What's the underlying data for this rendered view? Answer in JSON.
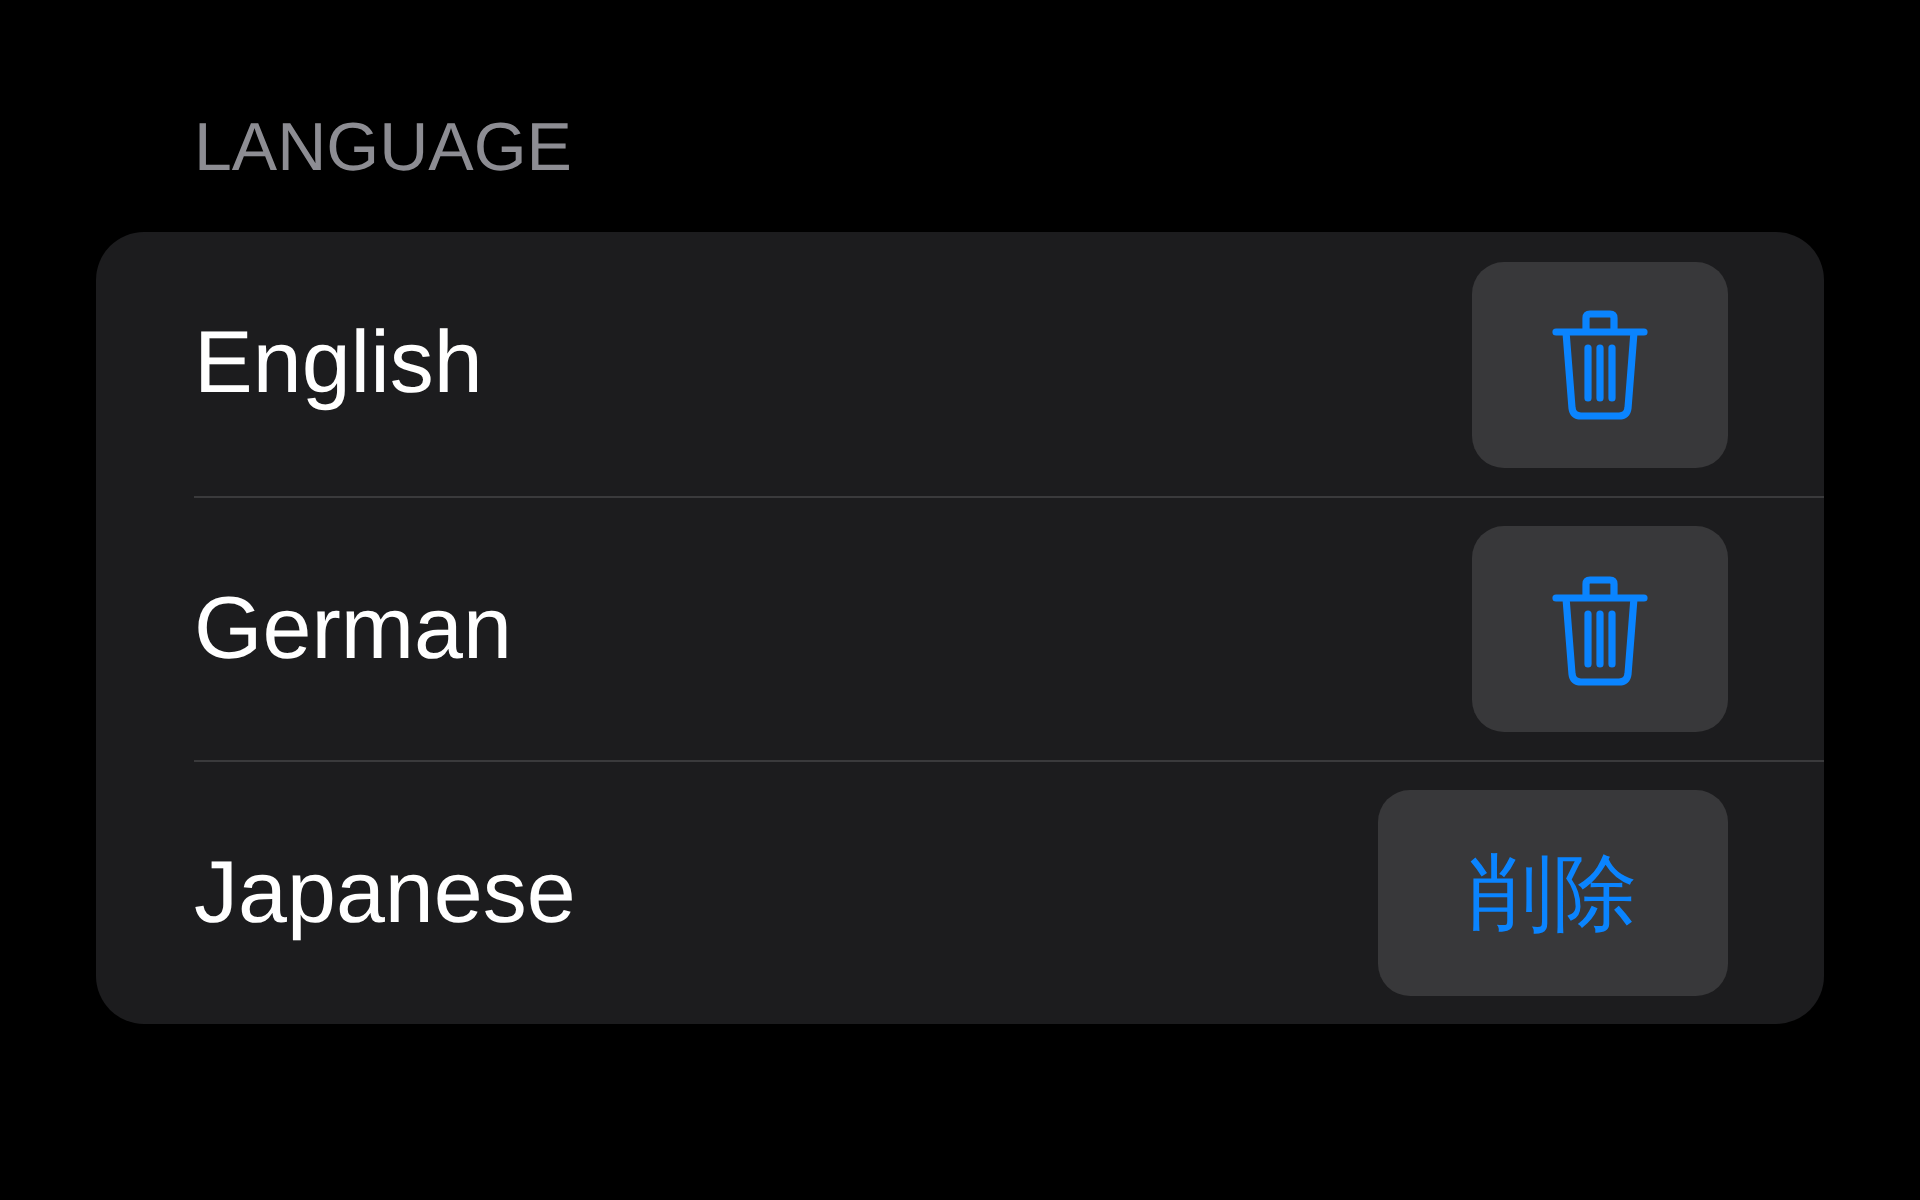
{
  "section": {
    "header": "LANGUAGE"
  },
  "languages": [
    {
      "name": "English",
      "action": {
        "kind": "icon"
      }
    },
    {
      "name": "German",
      "action": {
        "kind": "icon"
      }
    },
    {
      "name": "Japanese",
      "action": {
        "kind": "text",
        "label": "削除"
      }
    }
  ]
}
